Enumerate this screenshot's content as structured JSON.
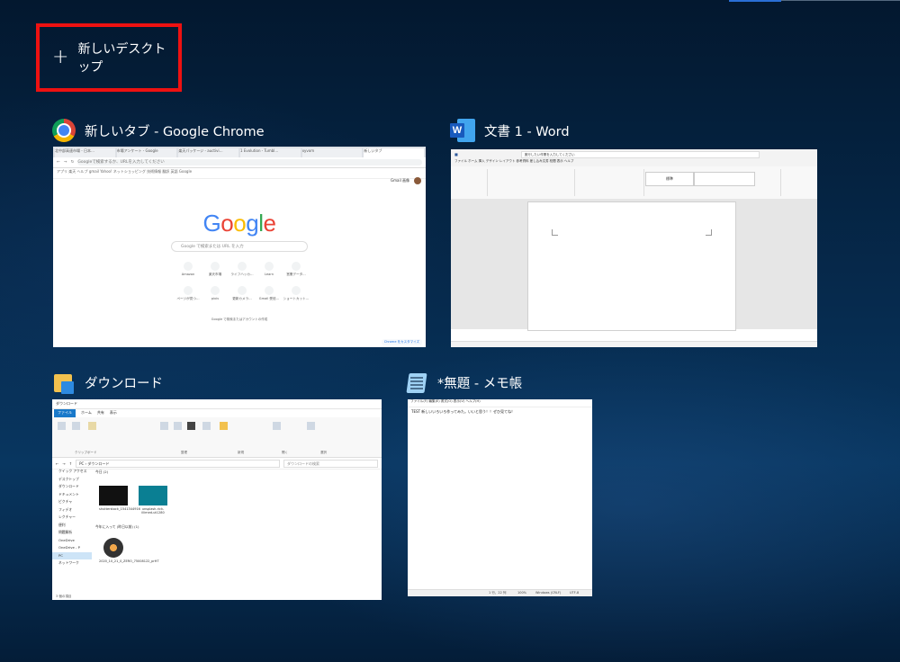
{
  "new_desktop": {
    "plus": "+",
    "label": "新しいデスクトップ"
  },
  "windows": {
    "chrome": {
      "title": "新しいタブ - Google Chrome",
      "icon": "chrome-icon",
      "thumb": {
        "tabs": [
          "北中部高速市場 - 日本…",
          "市場アンケート - Google",
          "楽天パッケージ - auctivi…",
          "1 Evolution - Tumbl…",
          "xyvom",
          "新しいタブ"
        ],
        "address_placeholder": "Googleで検索するか、URLを入力してください",
        "bookmarks": "アプリ  楽天  ヘルプ  gmail  Yahoo!  ネットショッピング  技術情報  翻訳  英語  Google",
        "logo": [
          "G",
          "o",
          "o",
          "g",
          "l",
          "e"
        ],
        "search_placeholder": "Google で検索または URL を入力",
        "top_links": "Gmail  画像",
        "shortcuts": [
          "Amazon",
          "楽天市場",
          "ライフハッカ…",
          "Learn",
          "営業データ…",
          "ページが見つ…",
          "pixiv",
          "更新カメラ…",
          "Gmail 受信…",
          "ショートカット…"
        ],
        "footer_text": "Chrome をカスタマイズ",
        "footer_mid": "Google で検索またはアカウントの作成"
      }
    },
    "word": {
      "title": "文書 1 - Word",
      "icon": "word-icon",
      "thumb": {
        "tabs": "ファイル  ホーム  挿入  デザイン  レイアウト  参考資料  差し込み文書  校閲  表示  ヘルプ",
        "search": "実行したい作業を入力してください",
        "style": "標準"
      }
    },
    "explorer": {
      "title": "ダウンロード",
      "icon": "folder-download-icon",
      "thumb": {
        "window_title": "ダウンロード",
        "tabs": [
          "ファイル",
          "ホーム",
          "共有",
          "表示"
        ],
        "ribbon_groups": [
          "クリップボード",
          "整理",
          "新規",
          "開く",
          "選択"
        ],
        "path": "PC › ダウンロード",
        "search_placeholder": "ダウンロードの検索",
        "nav": [
          "クイック アクセス",
          "デスクトップ",
          "ダウンロード",
          "ドキュメント",
          "ピクチャ",
          "フィデオ",
          "レクチャー",
          "便利",
          "問題解析",
          "OneDrive",
          "OneDrive - P",
          "PC",
          "ネットワーク"
        ],
        "group_today": "今日 (2)",
        "group_earlier": "今年に入って (昨日以前) (1)",
        "files": [
          "shutterstock_1541344916",
          "unsplash-rick-illimed-ut1280",
          "2020_10_21_0_ZERO_75008122_prHT"
        ],
        "status": "3 個の項目"
      }
    },
    "notepad": {
      "title": "*無題 - メモ帳",
      "icon": "notepad-icon",
      "thumb": {
        "menu": "ファイル(F)  編集(E)  書式(O)  表示(V)  ヘルプ(H)",
        "text": "TEST 新しいいろいろ作ってみた。いいと思う！！ぜひ見てね！",
        "status_pos": "1 行、22 列",
        "status_zoom": "100%",
        "status_eol": "Windows (CRLF)",
        "status_enc": "UTF-8"
      }
    }
  },
  "colors": {
    "highlight_border": "#ee1111",
    "accent": "#2a6fd6"
  }
}
